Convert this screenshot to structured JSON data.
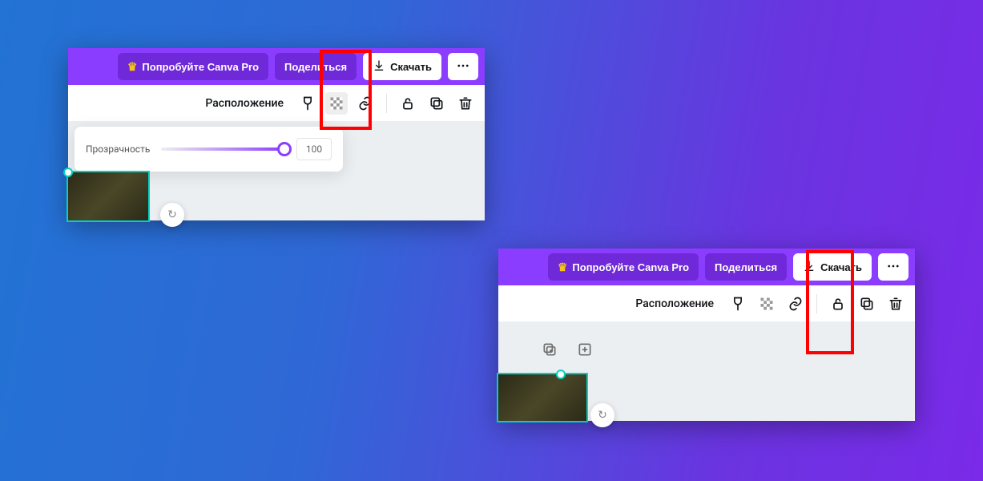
{
  "topbar": {
    "pro_label": "Попробуйте Canva Pro",
    "share_label": "Поделиться",
    "download_label": "Скачать",
    "more_label": "…"
  },
  "toolbar": {
    "position_label": "Расположение"
  },
  "transparency": {
    "label": "Прозрачность",
    "value": "100"
  }
}
